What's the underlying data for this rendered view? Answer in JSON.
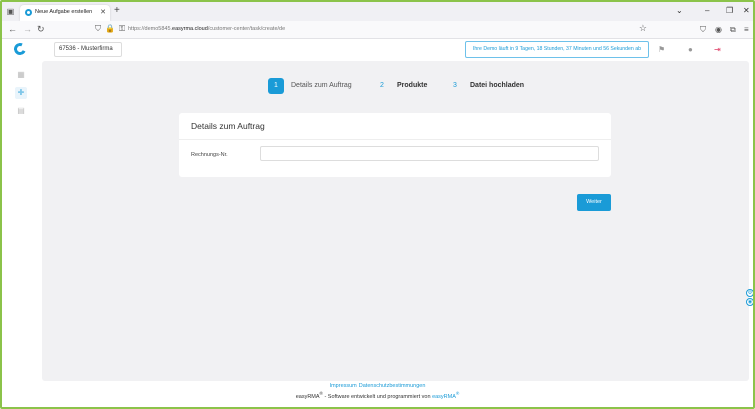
{
  "browser": {
    "tab_title": "Neue Aufgabe erstellen",
    "url_prefix": "https://demo5845.",
    "url_domain": "easyrma.cloud",
    "url_path": "/customer-center/task/create/de"
  },
  "header": {
    "tenant": "67536 - Musterfirma",
    "demo_notice": "Ihre Demo läuft in 9 Tagen, 18 Stunden, 37 Minuten und 56 Sekunden ab"
  },
  "steps": [
    {
      "num": "1",
      "label": "Details zum Auftrag"
    },
    {
      "num": "2",
      "label": "Produkte"
    },
    {
      "num": "3",
      "label": "Datei hochladen"
    }
  ],
  "card": {
    "title": "Details zum Auftrag",
    "field_label": "Rechnungs-Nr.",
    "field_value": ""
  },
  "next_label": "Weiter",
  "footer": {
    "impressum": "Impressum",
    "datenschutz": "Datenschutzbestimmungen",
    "credit_prefix": "easyRMA",
    "reg": "®",
    "credit_mid": " - Software entwickelt und programmiert von ",
    "credit_link": "easyRMA"
  },
  "colors": {
    "accent": "#1a9bd7",
    "frame": "#8bc34a",
    "logout": "#e0436a"
  }
}
